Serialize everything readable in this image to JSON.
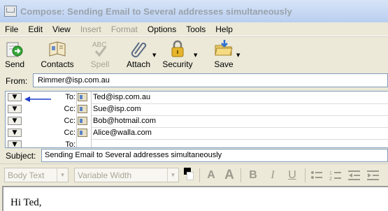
{
  "window": {
    "title": "Compose: Sending Email to Several addresses simultaneously"
  },
  "menu": [
    {
      "label": "File",
      "enabled": true
    },
    {
      "label": "Edit",
      "enabled": true
    },
    {
      "label": "View",
      "enabled": true
    },
    {
      "label": "Insert",
      "enabled": false
    },
    {
      "label": "Format",
      "enabled": false
    },
    {
      "label": "Options",
      "enabled": true
    },
    {
      "label": "Tools",
      "enabled": true
    },
    {
      "label": "Help",
      "enabled": true
    }
  ],
  "toolbar": {
    "send": "Send",
    "contacts": "Contacts",
    "spell": "Spell",
    "spell_icon_text": "ABC",
    "attach": "Attach",
    "security": "Security",
    "save": "Save"
  },
  "from": {
    "label": "From:",
    "value": "Rimmer@isp.com.au"
  },
  "recipients": [
    {
      "type": "To:",
      "address": "Ted@isp.com.au"
    },
    {
      "type": "Cc:",
      "address": "Sue@isp.com"
    },
    {
      "type": "Cc:",
      "address": "Bob@hotmail.com"
    },
    {
      "type": "Cc:",
      "address": "Alice@walla.com"
    },
    {
      "type": "To:",
      "address": ""
    }
  ],
  "subject": {
    "label": "Subject:",
    "value": "Sending Email to Several addresses simultaneously"
  },
  "format": {
    "paragraph_style": "Body Text",
    "font": "Variable Width",
    "bold": "B",
    "italic": "I",
    "underline": "U"
  },
  "body": {
    "text": "Hi Ted,"
  },
  "colors": {
    "title_text": "#9aa3ad",
    "arrow": "#1f3fc8",
    "field_border": "#7f9db9"
  }
}
